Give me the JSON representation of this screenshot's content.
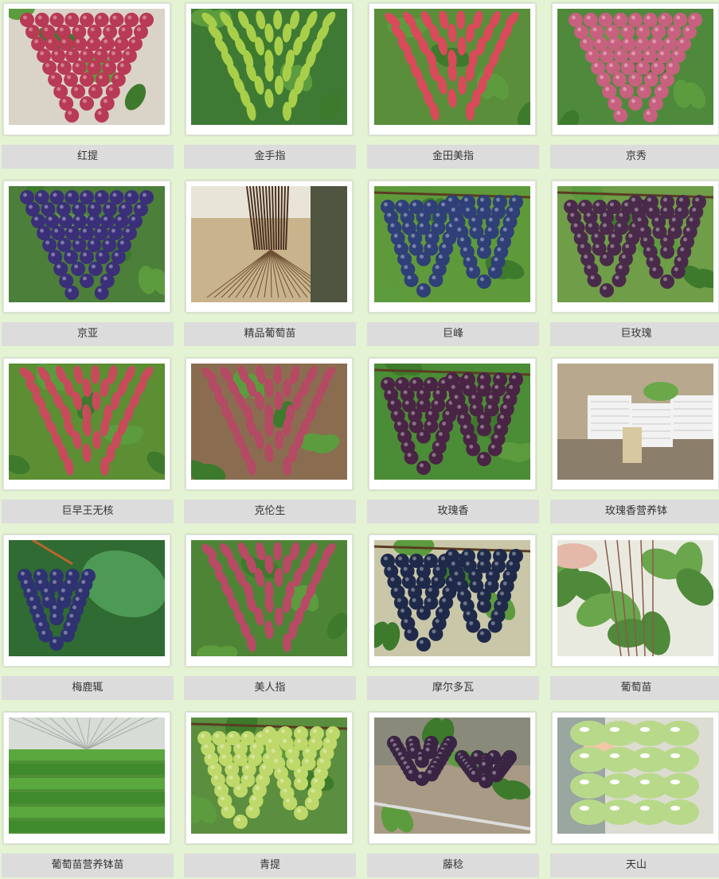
{
  "products": [
    {
      "name": "红提",
      "grape": "#b83a54",
      "bg": "#d9d3c8",
      "kind": "bunch"
    },
    {
      "name": "金手指",
      "grape": "#a9cf4a",
      "bg": "#3f7a34",
      "kind": "finger"
    },
    {
      "name": "金田美指",
      "grape": "#d94a5a",
      "bg": "#5a8e3a",
      "kind": "finger"
    },
    {
      "name": "京秀",
      "grape": "#c86080",
      "bg": "#4f8a3c",
      "kind": "bunch"
    },
    {
      "name": "京亚",
      "grape": "#3a2f78",
      "bg": "#4c7f3a",
      "kind": "bunch"
    },
    {
      "name": "精品葡萄苗",
      "grape": "#6b4e36",
      "bg": "#bfa884",
      "kind": "seedling"
    },
    {
      "name": "巨峰",
      "grape": "#2f3f78",
      "bg": "#5f9a3a",
      "kind": "bunch2"
    },
    {
      "name": "巨玫瑰",
      "grape": "#4a2a4a",
      "bg": "#6f9d48",
      "kind": "bunch2"
    },
    {
      "name": "巨早王无核",
      "grape": "#c84b5c",
      "bg": "#5c8e34",
      "kind": "finger"
    },
    {
      "name": "克伦生",
      "grape": "#b44a64",
      "bg": "#8a6d50",
      "kind": "finger"
    },
    {
      "name": "玫瑰香",
      "grape": "#4a2444",
      "bg": "#4b8c36",
      "kind": "bunch2"
    },
    {
      "name": "玫瑰香营养钵",
      "grape": "#e9e9e9",
      "bg": "#8a7a66",
      "kind": "crates"
    },
    {
      "name": "梅鹿辄",
      "grape": "#2f3270",
      "bg": "#2f6b32",
      "kind": "small"
    },
    {
      "name": "美人指",
      "grape": "#b84a66",
      "bg": "#4e8436",
      "kind": "finger"
    },
    {
      "name": "摩尔多瓦",
      "grape": "#1f2a4a",
      "bg": "#c9c7a8",
      "kind": "bunch2"
    },
    {
      "name": "葡萄苗",
      "grape": "#5f9a3a",
      "bg": "#e9eadf",
      "kind": "leaves"
    },
    {
      "name": "葡萄苗营养钵苗",
      "grape": "#3f8a2c",
      "bg": "#4e8f36",
      "kind": "greenhouse"
    },
    {
      "name": "青提",
      "grape": "#bfd86a",
      "bg": "#5b8e3e",
      "kind": "bunch2"
    },
    {
      "name": "藤稔",
      "grape": "#3a2444",
      "bg": "#8a8a7a",
      "kind": "vine"
    },
    {
      "name": "天山",
      "grape": "#b9d98a",
      "bg": "#dcdcd2",
      "kind": "closeup"
    }
  ]
}
